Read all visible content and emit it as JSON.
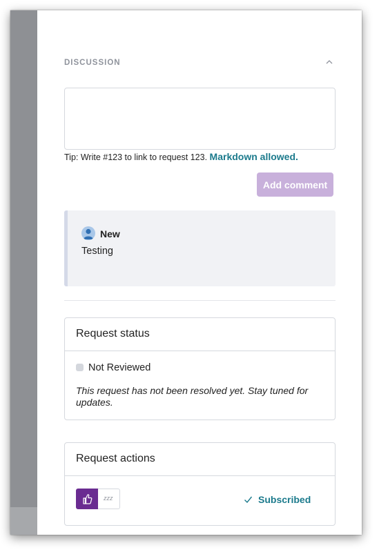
{
  "discussion": {
    "section_title": "DISCUSSION",
    "comment_placeholder": "",
    "tip_text": "Tip: Write #123 to link to request 123.",
    "markdown_link": "Markdown allowed.",
    "add_comment_label": "Add comment"
  },
  "comments": [
    {
      "author": "New",
      "body": "Testing"
    }
  ],
  "request_status": {
    "title": "Request status",
    "status": "Not Reviewed",
    "status_color": "#d4d7dd",
    "note": "This request has not been resolved yet. Stay tuned for updates."
  },
  "request_actions": {
    "title": "Request actions",
    "upvote_icon": "thumbs-up-icon",
    "snooze_icon": "zzz-icon",
    "snooze_glyph": "zzz",
    "subscribed_label": "Subscribed"
  },
  "colors": {
    "accent": "#6a2c91",
    "link": "#1b7a8c",
    "button_disabled": "#c8b0db"
  }
}
